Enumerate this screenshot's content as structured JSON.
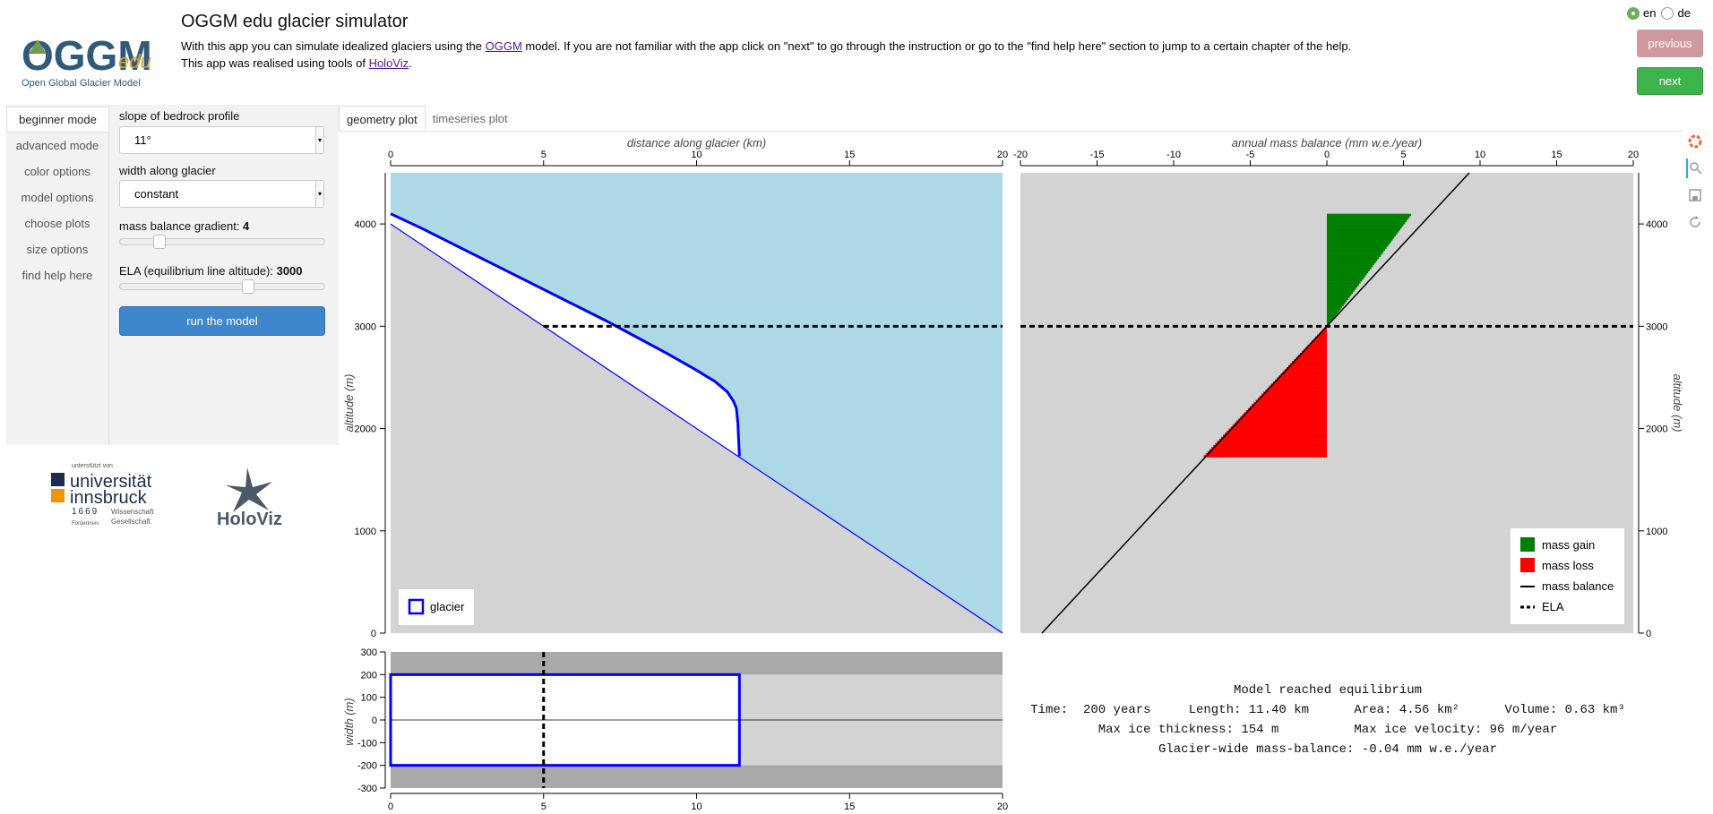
{
  "header": {
    "logo_text": "Open Global Glacier Model",
    "title": "OGGM edu glacier simulator",
    "intro_part1": "With this app you can simulate idealized glaciers using the ",
    "intro_link": "OGGM",
    "intro_part2": " model. If you are not familiar with the app click on \"next\" to go through the instruction or go to the \"find help here\" section to jump to a certain chapter of the help.",
    "realised_part1": "This app was realised using tools of ",
    "realised_link": "HoloViz",
    "realised_part2": "."
  },
  "language": {
    "options": [
      "en",
      "de"
    ],
    "selected": "en"
  },
  "nav": {
    "previous": "previous",
    "next": "next"
  },
  "sidebar": {
    "items": [
      {
        "label": "beginner mode",
        "active": true
      },
      {
        "label": "advanced mode"
      },
      {
        "label": "color options"
      },
      {
        "label": "model options"
      },
      {
        "label": "choose plots"
      },
      {
        "label": "size options"
      },
      {
        "label": "find help here"
      }
    ]
  },
  "widgets": {
    "slope_label": "slope of bedrock profile",
    "slope_value": "11°",
    "width_label": "width along glacier",
    "width_value": "constant",
    "mb_gradient_label": "mass balance gradient: ",
    "mb_gradient_value": "4",
    "mb_gradient_level": 0.17,
    "ela_label": "ELA (equilibrium line altitude): ",
    "ela_value": "3000",
    "ela_level": 0.63,
    "run_button": "run the model"
  },
  "logos": {
    "uibk_supported": "unterstützt von",
    "uibk_name1": "universität",
    "uibk_name2": "innsbruck",
    "uibk_year": "1669",
    "uibk_wiss": "Wissenschaft",
    "uibk_ges": "Gesellschaft",
    "uibk_foerder": "Förderkreis",
    "holoviz": "HoloViz"
  },
  "tabs": [
    "geometry plot",
    "timeseries plot"
  ],
  "colors": {
    "ice": "#add8e6",
    "bedrock": "#d3d3d3",
    "glacier_line": "#0000ff",
    "mass_gain": "#008000",
    "mass_loss": "#ff0000"
  },
  "chart_data": [
    {
      "type": "area",
      "name": "geometry",
      "xlabel": "distance along glacier (km)",
      "ylabel": "altitude (m)",
      "xlim": [
        0,
        20
      ],
      "ylim": [
        0,
        4500
      ],
      "xticks": [
        0,
        5,
        10,
        15,
        20
      ],
      "yticks": [
        0,
        1000,
        2000,
        3000,
        4000
      ],
      "bed": {
        "x": [
          0,
          20
        ],
        "y": [
          4000,
          0
        ]
      },
      "glacier_surface": {
        "x": [
          0,
          1,
          2,
          3,
          4,
          5,
          6,
          7,
          8,
          9,
          10,
          10.6,
          11.0,
          11.2,
          11.3,
          11.35,
          11.4
        ],
        "y": [
          4100,
          3960,
          3810,
          3660,
          3510,
          3360,
          3210,
          3060,
          2900,
          2740,
          2570,
          2460,
          2360,
          2270,
          2200,
          2050,
          1730
        ]
      },
      "ela": 3000,
      "ela_x_start": 5,
      "legend": [
        "glacier"
      ],
      "legend_position": "bottom-left"
    },
    {
      "type": "bar",
      "name": "mass balance",
      "xlabel": "annual mass balance (mm w.e./year)",
      "ylabel": "altitude (m)",
      "xlim": [
        -20,
        20
      ],
      "ylim": [
        0,
        4500
      ],
      "xticks": [
        -20,
        -15,
        -10,
        -5,
        0,
        5,
        10,
        15,
        20
      ],
      "yticks": [
        0,
        1000,
        2000,
        3000,
        4000
      ],
      "gradient": 4,
      "ela": 3000,
      "gain_range": [
        3000,
        4100
      ],
      "loss_range": [
        1720,
        3000
      ],
      "legend": [
        "mass gain",
        "mass loss",
        "mass balance",
        "ELA"
      ],
      "legend_position": "bottom-right"
    },
    {
      "type": "area",
      "name": "width",
      "xlabel": "",
      "ylabel": "width (m)",
      "xlim": [
        0,
        20
      ],
      "ylim": [
        -300,
        300
      ],
      "xticks": [
        0,
        5,
        10,
        15,
        20
      ],
      "yticks": [
        -300,
        -200,
        -100,
        0,
        100,
        200,
        300
      ],
      "bed_width": 200,
      "glacier_length": 11.4,
      "ela_x": 5
    }
  ],
  "status": {
    "line1": "Model reached equilibrium",
    "line2": "Time:  200 years     Length: 11.40 km      Area: 4.56 km²      Volume: 0.63 km³",
    "line3": "Max ice thickness: 154 m          Max ice velocity: 96 m/year",
    "line4": "Glacier-wide mass-balance: -0.04 mm w.e./year"
  }
}
